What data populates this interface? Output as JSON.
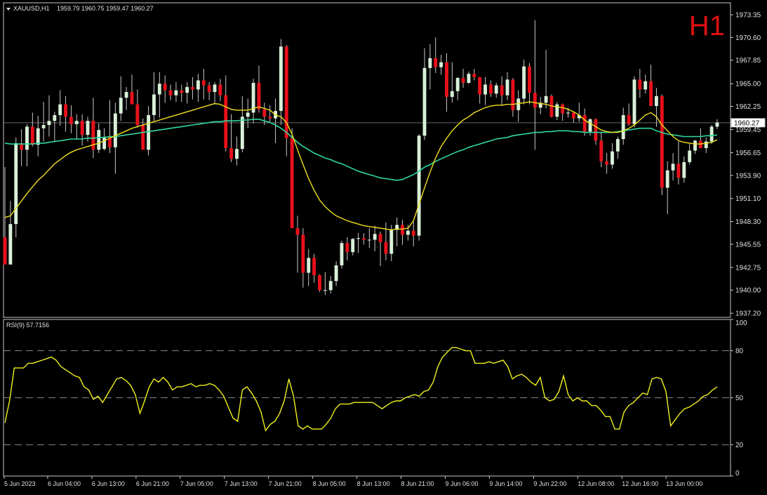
{
  "header": {
    "symbol_label": "XAUUSD,H1",
    "ohlc_label": "1959.79 1960.75 1959.47 1960.27",
    "timeframe_badge": "H1"
  },
  "rsi_panel": {
    "label": "RSI(9) 57.7156"
  },
  "colors": {
    "background": "#000000",
    "frame": "#c8c8c8",
    "bull_body": "#d8f0d8",
    "bear_body": "#e8101a",
    "wick": "#c8c8c8",
    "ma_fast": "#f0e020",
    "ma_slow": "#30d8a0",
    "rsi_line": "#f0f020",
    "text": "#e0e0e0",
    "badge": "#e01010"
  },
  "chart_data": [
    {
      "type": "candlestick",
      "title": "XAUUSD,H1",
      "price_ticks": [
        "1973.35",
        "1970.60",
        "1967.85",
        "1965.00",
        "1962.25",
        "1959.45",
        "1956.65",
        "1953.90",
        "1951.10",
        "1948.30",
        "1945.55",
        "1942.75",
        "1940.00",
        "1937.20"
      ],
      "current_price": "1960.27",
      "ylim": [
        1936.7,
        1974.8
      ],
      "x_tick_labels": [
        "5 Jun 2023",
        "6 Jun 04:00",
        "6 Jun 13:00",
        "6 Jun 21:00",
        "7 Jun 05:00",
        "7 Jun 13:00",
        "7 Jun 21:00",
        "8 Jun 05:00",
        "8 Jun 13:00",
        "8 Jun 21:00",
        "9 Jun 06:00",
        "9 Jun 14:00",
        "9 Jun 22:00",
        "12 Jun 08:00",
        "12 Jun 16:00",
        "13 Jun 00:00"
      ],
      "x_tick_index": [
        0,
        8,
        16,
        24,
        32,
        40,
        48,
        56,
        64,
        72,
        80,
        88,
        96,
        104,
        112,
        120
      ],
      "candles": [
        [
          1946.4,
          1954.9,
          1943.6,
          1943.1
        ],
        [
          1943.1,
          1950.8,
          1943.7,
          1948.0
        ],
        [
          1948.0,
          1958.5,
          1946.4,
          1957.8
        ],
        [
          1957.8,
          1959.5,
          1955.0,
          1957.0
        ],
        [
          1957.0,
          1960.1,
          1955.0,
          1959.8
        ],
        [
          1959.8,
          1961.5,
          1957.4,
          1957.6
        ],
        [
          1957.6,
          1961.1,
          1956.2,
          1959.6
        ],
        [
          1959.6,
          1962.8,
          1958.0,
          1960.0
        ],
        [
          1960.0,
          1963.6,
          1958.6,
          1960.5
        ],
        [
          1960.5,
          1961.6,
          1957.9,
          1961.2
        ],
        [
          1961.2,
          1964.2,
          1959.9,
          1962.5
        ],
        [
          1962.5,
          1963.5,
          1959.2,
          1961.0
        ],
        [
          1961.0,
          1962.4,
          1959.0,
          1960.1
        ],
        [
          1960.1,
          1961.3,
          1958.3,
          1960.5
        ],
        [
          1960.5,
          1961.3,
          1957.5,
          1958.8
        ],
        [
          1958.8,
          1961.0,
          1958.0,
          1960.5
        ],
        [
          1960.5,
          1963.3,
          1956.0,
          1957.0
        ],
        [
          1957.0,
          1960.2,
          1956.6,
          1959.4
        ],
        [
          1957.1,
          1959.6,
          1956.9,
          1958.5
        ],
        [
          1958.5,
          1963.0,
          1956.6,
          1957.3
        ],
        [
          1957.3,
          1962.7,
          1954.1,
          1961.4
        ],
        [
          1961.4,
          1965.9,
          1960.5,
          1963.3
        ],
        [
          1963.3,
          1964.6,
          1961.8,
          1964.0
        ],
        [
          1964.0,
          1966.1,
          1963.5,
          1962.5
        ],
        [
          1962.5,
          1964.3,
          1959.7,
          1960.0
        ],
        [
          1960.0,
          1960.8,
          1957.4,
          1957.0
        ],
        [
          1957.0,
          1962.3,
          1956.3,
          1961.2
        ],
        [
          1961.2,
          1966.4,
          1960.5,
          1963.7
        ],
        [
          1963.7,
          1966.4,
          1960.9,
          1965.0
        ],
        [
          1965.0,
          1966.0,
          1962.7,
          1964.2
        ],
        [
          1964.2,
          1964.9,
          1963.0,
          1963.6
        ],
        [
          1963.6,
          1965.2,
          1962.8,
          1964.2
        ],
        [
          1964.2,
          1964.9,
          1962.8,
          1963.9
        ],
        [
          1963.9,
          1965.2,
          1962.6,
          1964.6
        ],
        [
          1964.6,
          1965.8,
          1963.1,
          1964.3
        ],
        [
          1964.3,
          1966.2,
          1962.8,
          1965.4
        ],
        [
          1965.4,
          1966.8,
          1963.1,
          1964.8
        ],
        [
          1964.8,
          1965.2,
          1963.0,
          1964.0
        ],
        [
          1964.0,
          1965.2,
          1962.5,
          1964.9
        ],
        [
          1964.9,
          1965.6,
          1962.9,
          1963.6
        ],
        [
          1963.6,
          1966.0,
          1956.8,
          1957.2
        ],
        [
          1957.2,
          1961.3,
          1955.5,
          1955.9
        ],
        [
          1955.9,
          1958.6,
          1955.1,
          1957.1
        ],
        [
          1957.1,
          1963.5,
          1956.7,
          1961.0
        ],
        [
          1961.0,
          1963.2,
          1959.6,
          1961.5
        ],
        [
          1961.5,
          1965.6,
          1960.2,
          1965.1
        ],
        [
          1965.1,
          1967.2,
          1961.5,
          1961.9
        ],
        [
          1961.9,
          1962.7,
          1960.0,
          1961.0
        ],
        [
          1961.0,
          1962.4,
          1960.3,
          1960.8
        ],
        [
          1960.8,
          1963.2,
          1957.8,
          1961.7
        ],
        [
          1961.7,
          1970.4,
          1960.0,
          1969.5
        ],
        [
          1969.5,
          1969.7,
          1956.2,
          1958.4
        ],
        [
          1958.4,
          1959.6,
          1947.6,
          1947.5
        ],
        [
          1947.5,
          1949.0,
          1942.1,
          1946.7
        ],
        [
          1946.7,
          1947.5,
          1940.3,
          1942.1
        ],
        [
          1942.1,
          1945.0,
          1940.5,
          1943.9
        ],
        [
          1943.9,
          1944.4,
          1940.9,
          1941.8
        ],
        [
          1941.8,
          1941.9,
          1939.8,
          1940.0
        ],
        [
          1940.0,
          1942.2,
          1939.4,
          1940.0
        ],
        [
          1940.0,
          1941.7,
          1939.6,
          1941.1
        ],
        [
          1941.1,
          1943.5,
          1940.5,
          1943.0
        ],
        [
          1943.0,
          1946.0,
          1942.6,
          1945.7
        ],
        [
          1945.7,
          1946.4,
          1943.6,
          1944.6
        ],
        [
          1944.6,
          1946.3,
          1944.2,
          1946.2
        ],
        [
          1946.2,
          1946.9,
          1944.5,
          1946.3
        ],
        [
          1946.3,
          1946.9,
          1945.5,
          1946.1
        ],
        [
          1946.1,
          1947.5,
          1945.1,
          1946.1
        ],
        [
          1946.1,
          1947.8,
          1944.7,
          1946.8
        ],
        [
          1946.8,
          1947.1,
          1942.9,
          1945.8
        ],
        [
          1945.8,
          1948.2,
          1943.6,
          1944.4
        ],
        [
          1944.4,
          1947.9,
          1943.5,
          1947.3
        ],
        [
          1947.3,
          1948.8,
          1945.3,
          1947.9
        ],
        [
          1947.9,
          1948.5,
          1945.5,
          1946.7
        ],
        [
          1946.7,
          1947.9,
          1946.0,
          1947.2
        ],
        [
          1947.2,
          1948.3,
          1945.3,
          1946.6
        ],
        [
          1946.6,
          1958.9,
          1946.0,
          1958.7
        ],
        [
          1958.7,
          1969.3,
          1958.2,
          1966.9
        ],
        [
          1966.9,
          1969.8,
          1964.3,
          1968.1
        ],
        [
          1968.1,
          1970.6,
          1966.3,
          1967.0
        ],
        [
          1967.0,
          1968.5,
          1966.1,
          1967.6
        ],
        [
          1967.6,
          1968.7,
          1961.6,
          1963.4
        ],
        [
          1963.4,
          1967.6,
          1962.7,
          1964.1
        ],
        [
          1964.1,
          1965.8,
          1963.0,
          1965.7
        ],
        [
          1965.7,
          1966.8,
          1964.5,
          1965.1
        ],
        [
          1965.1,
          1966.5,
          1965.0,
          1966.2
        ],
        [
          1966.2,
          1966.8,
          1965.4,
          1965.8
        ],
        [
          1965.8,
          1965.8,
          1962.6,
          1963.7
        ],
        [
          1963.7,
          1965.8,
          1962.4,
          1964.9
        ],
        [
          1964.9,
          1965.4,
          1963.4,
          1963.8
        ],
        [
          1963.8,
          1965.1,
          1963.3,
          1964.8
        ],
        [
          1964.8,
          1965.9,
          1962.3,
          1963.6
        ],
        [
          1963.6,
          1966.4,
          1963.0,
          1965.5
        ],
        [
          1965.5,
          1965.7,
          1961.0,
          1961.8
        ],
        [
          1961.8,
          1964.2,
          1960.4,
          1963.2
        ],
        [
          1963.2,
          1967.9,
          1962.5,
          1967.1
        ],
        [
          1967.1,
          1967.5,
          1962.5,
          1963.9
        ],
        [
          1963.9,
          1972.7,
          1957.0,
          1962.1
        ],
        [
          1962.1,
          1963.4,
          1961.3,
          1962.7
        ],
        [
          1962.7,
          1969.1,
          1962.0,
          1963.5
        ],
        [
          1963.5,
          1963.7,
          1960.9,
          1961.0
        ],
        [
          1961.0,
          1962.8,
          1960.6,
          1962.5
        ],
        [
          1962.5,
          1962.6,
          1960.5,
          1961.4
        ],
        [
          1961.4,
          1962.1,
          1960.9,
          1961.5
        ],
        [
          1961.5,
          1961.6,
          1960.3,
          1960.8
        ],
        [
          1960.8,
          1962.7,
          1960.4,
          1961.2
        ],
        [
          1961.2,
          1962.0,
          1958.7,
          1959.2
        ],
        [
          1959.2,
          1960.8,
          1958.7,
          1960.7
        ],
        [
          1960.7,
          1960.8,
          1957.6,
          1958.1
        ],
        [
          1958.1,
          1959.2,
          1954.9,
          1955.6
        ],
        [
          1955.6,
          1956.6,
          1954.1,
          1955.2
        ],
        [
          1955.2,
          1957.8,
          1954.7,
          1956.8
        ],
        [
          1956.8,
          1958.6,
          1955.9,
          1958.3
        ],
        [
          1958.3,
          1962.1,
          1957.6,
          1961.2
        ],
        [
          1961.2,
          1962.6,
          1959.9,
          1960.1
        ],
        [
          1960.1,
          1965.9,
          1959.7,
          1965.5
        ],
        [
          1965.5,
          1966.8,
          1963.3,
          1964.3
        ],
        [
          1964.3,
          1966.1,
          1963.8,
          1965.3
        ],
        [
          1965.3,
          1967.3,
          1964.6,
          1962.3
        ],
        [
          1962.3,
          1964.5,
          1959.8,
          1963.5
        ],
        [
          1963.5,
          1963.7,
          1951.5,
          1952.4
        ],
        [
          1952.4,
          1955.6,
          1949.2,
          1954.5
        ],
        [
          1954.5,
          1956.6,
          1953.3,
          1955.3
        ],
        [
          1955.3,
          1958.0,
          1952.8,
          1953.6
        ],
        [
          1953.6,
          1956.2,
          1953.0,
          1955.5
        ],
        [
          1955.5,
          1957.7,
          1955.2,
          1956.9
        ],
        [
          1956.9,
          1958.2,
          1956.5,
          1958.1
        ],
        [
          1958.1,
          1959.6,
          1957.3,
          1957.2
        ],
        [
          1957.2,
          1958.5,
          1956.6,
          1958.0
        ],
        [
          1958.0,
          1960.0,
          1957.7,
          1959.8
        ],
        [
          1959.8,
          1960.7,
          1959.5,
          1960.3
        ]
      ],
      "ma_fast_series": [
        1948.8,
        1949.0,
        1949.9,
        1950.8,
        1951.7,
        1952.5,
        1953.3,
        1953.9,
        1954.6,
        1955.3,
        1955.8,
        1956.3,
        1956.7,
        1957.0,
        1957.2,
        1957.4,
        1957.6,
        1957.8,
        1958.1,
        1958.4,
        1958.7,
        1959.0,
        1959.3,
        1959.6,
        1959.8,
        1960.0,
        1960.2,
        1960.4,
        1960.6,
        1960.8,
        1961.0,
        1961.2,
        1961.4,
        1961.6,
        1961.8,
        1962.0,
        1962.2,
        1962.4,
        1962.6,
        1962.5,
        1962.2,
        1961.9,
        1961.8,
        1961.8,
        1961.8,
        1962.0,
        1962.2,
        1962.0,
        1961.8,
        1961.2,
        1961.0,
        1960.3,
        1958.9,
        1957.0,
        1955.2,
        1953.5,
        1952.1,
        1950.9,
        1950.1,
        1949.5,
        1949.0,
        1948.7,
        1948.4,
        1948.2,
        1948.0,
        1947.8,
        1947.7,
        1947.6,
        1947.5,
        1947.4,
        1947.3,
        1947.4,
        1947.4,
        1947.5,
        1948.4,
        1950.4,
        1952.4,
        1954.3,
        1956.0,
        1957.4,
        1958.4,
        1959.3,
        1960.0,
        1960.6,
        1961.0,
        1961.5,
        1961.8,
        1962.1,
        1962.3,
        1962.4,
        1962.4,
        1962.5,
        1962.5,
        1962.6,
        1962.7,
        1962.8,
        1962.7,
        1962.6,
        1962.5,
        1962.3,
        1962.2,
        1962.1,
        1961.9,
        1961.6,
        1961.2,
        1960.6,
        1960.2,
        1959.8,
        1959.4,
        1959.2,
        1959.1,
        1959.1,
        1959.3,
        1959.6,
        1960.0,
        1960.6,
        1961.2,
        1961.5,
        1961.0,
        1960.0,
        1959.3,
        1958.6,
        1958.1,
        1957.9,
        1957.8,
        1957.7,
        1957.7,
        1957.8,
        1957.9,
        1958.2
      ],
      "ma_slow_series": [
        1957.8,
        1957.7,
        1957.7,
        1957.7,
        1957.7,
        1957.7,
        1957.8,
        1957.8,
        1957.9,
        1958.0,
        1958.1,
        1958.2,
        1958.3,
        1958.3,
        1958.3,
        1958.4,
        1958.4,
        1958.5,
        1958.5,
        1958.6,
        1958.6,
        1958.7,
        1958.8,
        1958.9,
        1959.0,
        1959.1,
        1959.2,
        1959.3,
        1959.4,
        1959.5,
        1959.6,
        1959.7,
        1959.8,
        1959.9,
        1960.0,
        1960.1,
        1960.2,
        1960.3,
        1960.4,
        1960.4,
        1960.5,
        1960.5,
        1960.5,
        1960.6,
        1960.6,
        1960.7,
        1960.7,
        1960.5,
        1960.3,
        1960.0,
        1959.6,
        1959.1,
        1958.5,
        1957.9,
        1957.4,
        1957.0,
        1956.6,
        1956.3,
        1956.0,
        1955.8,
        1955.5,
        1955.3,
        1955.0,
        1954.7,
        1954.4,
        1954.2,
        1954.0,
        1953.8,
        1953.6,
        1953.5,
        1953.4,
        1953.3,
        1953.4,
        1953.7,
        1954.0,
        1954.4,
        1954.9,
        1955.2,
        1955.6,
        1955.9,
        1956.2,
        1956.5,
        1956.8,
        1957.0,
        1957.3,
        1957.5,
        1957.7,
        1957.9,
        1958.1,
        1958.3,
        1958.4,
        1958.5,
        1958.7,
        1958.8,
        1958.9,
        1959.0,
        1959.1,
        1959.1,
        1959.2,
        1959.2,
        1959.3,
        1959.3,
        1959.3,
        1959.2,
        1959.2,
        1959.1,
        1959.1,
        1959.1,
        1959.1,
        1959.1,
        1959.1,
        1959.2,
        1959.3,
        1959.4,
        1959.5,
        1959.6,
        1959.6,
        1959.6,
        1959.3,
        1959.1,
        1958.9,
        1958.8,
        1958.7,
        1958.6,
        1958.6,
        1958.6,
        1958.6,
        1958.7,
        1958.7,
        1958.8
      ]
    },
    {
      "type": "line",
      "title": "RSI(9) 57.7156",
      "y_ticks": [
        "100",
        "80",
        "50",
        "20",
        "0"
      ],
      "levels": [
        20,
        50,
        80
      ],
      "ylim": [
        0,
        100
      ],
      "values": [
        34,
        48,
        69,
        69,
        69,
        72,
        72,
        73,
        74,
        75,
        76,
        74,
        70,
        68,
        66,
        64,
        63,
        57,
        55,
        49,
        51,
        47,
        52,
        57,
        62,
        63,
        61,
        58,
        52,
        40,
        48,
        57,
        62,
        60,
        63,
        60,
        55,
        57,
        57,
        58,
        59,
        57,
        58,
        58,
        59,
        58,
        55,
        51,
        44,
        37,
        35,
        55,
        57,
        53,
        48,
        41,
        29,
        33,
        35,
        40,
        48,
        62,
        51,
        32,
        30,
        32,
        30,
        30,
        30,
        33,
        37,
        43,
        46,
        46,
        46,
        47,
        47,
        47,
        47,
        47,
        45,
        43,
        45,
        47,
        48,
        48,
        50,
        51,
        52,
        51,
        54,
        55,
        60,
        70,
        76,
        79,
        82,
        82,
        81,
        80,
        80,
        72,
        72,
        72,
        73,
        72,
        73,
        74,
        70,
        62,
        64,
        65,
        63,
        60,
        58,
        63,
        50,
        48,
        49,
        54,
        64,
        52,
        48,
        50,
        48,
        48,
        45,
        45,
        42,
        38,
        38,
        30,
        30,
        41,
        45,
        47,
        50,
        53,
        52,
        62,
        63,
        62,
        54,
        32,
        36,
        40,
        43,
        44,
        46,
        48,
        51,
        52,
        55,
        57
      ]
    }
  ]
}
